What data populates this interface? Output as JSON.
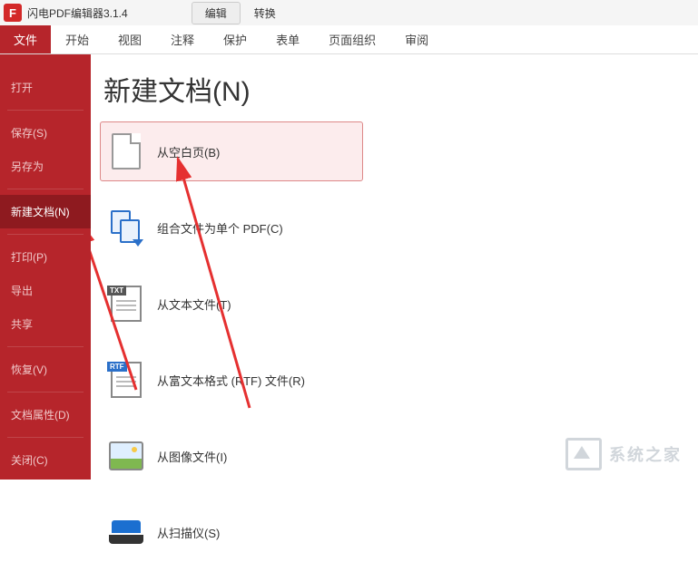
{
  "app": {
    "title": "闪电PDF编辑器3.1.4",
    "icon_letter": "F"
  },
  "top_tabs": [
    {
      "label": "编辑",
      "active": true
    },
    {
      "label": "转换",
      "active": false
    }
  ],
  "ribbon": {
    "file": "文件",
    "items": [
      "开始",
      "视图",
      "注释",
      "保护",
      "表单",
      "页面组织",
      "审阅"
    ]
  },
  "sidebar": {
    "groups": [
      [
        "打开"
      ],
      [
        "保存(S)",
        "另存为"
      ],
      [
        "新建文档(N)"
      ],
      [
        "打印(P)",
        "导出",
        "共享"
      ],
      [
        "恢复(V)"
      ],
      [
        "文档属性(D)"
      ],
      [
        "关闭(C)"
      ]
    ],
    "active": "新建文档(N)"
  },
  "content": {
    "title": "新建文档(N)",
    "options": [
      {
        "id": "from-blank",
        "label": "从空白页(B)",
        "highlight": true
      },
      {
        "id": "combine",
        "label": "组合文件为单个 PDF(C)"
      },
      {
        "id": "from-text",
        "label": "从文本文件(T)"
      },
      {
        "id": "from-rtf",
        "label": "从富文本格式 (RTF) 文件(R)"
      },
      {
        "id": "from-image",
        "label": "从图像文件(I)"
      },
      {
        "id": "from-scanner",
        "label": "从扫描仪(S)"
      }
    ]
  },
  "badges": {
    "txt": "TXT",
    "rtf": "RTF"
  },
  "watermark": {
    "text": "系统之家"
  }
}
